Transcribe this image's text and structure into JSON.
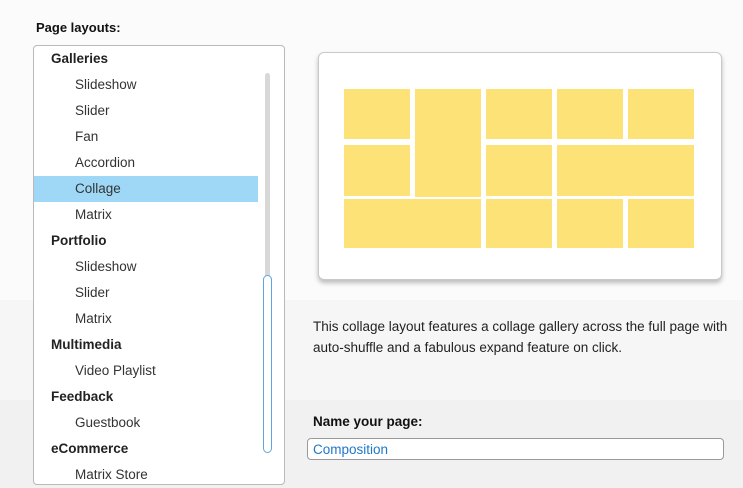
{
  "page_layouts_label": "Page layouts:",
  "layouts": [
    {
      "type": "group",
      "label": "Galleries"
    },
    {
      "type": "item",
      "label": "Slideshow"
    },
    {
      "type": "item",
      "label": "Slider"
    },
    {
      "type": "item",
      "label": "Fan"
    },
    {
      "type": "item",
      "label": "Accordion"
    },
    {
      "type": "item",
      "label": "Collage",
      "selected": true
    },
    {
      "type": "item",
      "label": "Matrix"
    },
    {
      "type": "group",
      "label": "Portfolio"
    },
    {
      "type": "item",
      "label": "Slideshow"
    },
    {
      "type": "item",
      "label": "Slider"
    },
    {
      "type": "item",
      "label": "Matrix"
    },
    {
      "type": "group",
      "label": "Multimedia"
    },
    {
      "type": "item",
      "label": "Video Playlist"
    },
    {
      "type": "group",
      "label": "Feedback"
    },
    {
      "type": "item",
      "label": "Guestbook"
    },
    {
      "type": "group",
      "label": "eCommerce"
    },
    {
      "type": "item",
      "label": "Matrix Store"
    }
  ],
  "preview": {
    "tile_color": "#fde277"
  },
  "description": "This collage layout features a collage gallery across the full page with auto-shuffle and a fabulous expand feature on click.",
  "name_label": "Name your page:",
  "name_input": {
    "value": "Composition"
  },
  "colors": {
    "selection": "#9ed8f6",
    "input_text": "#1f77c9"
  }
}
